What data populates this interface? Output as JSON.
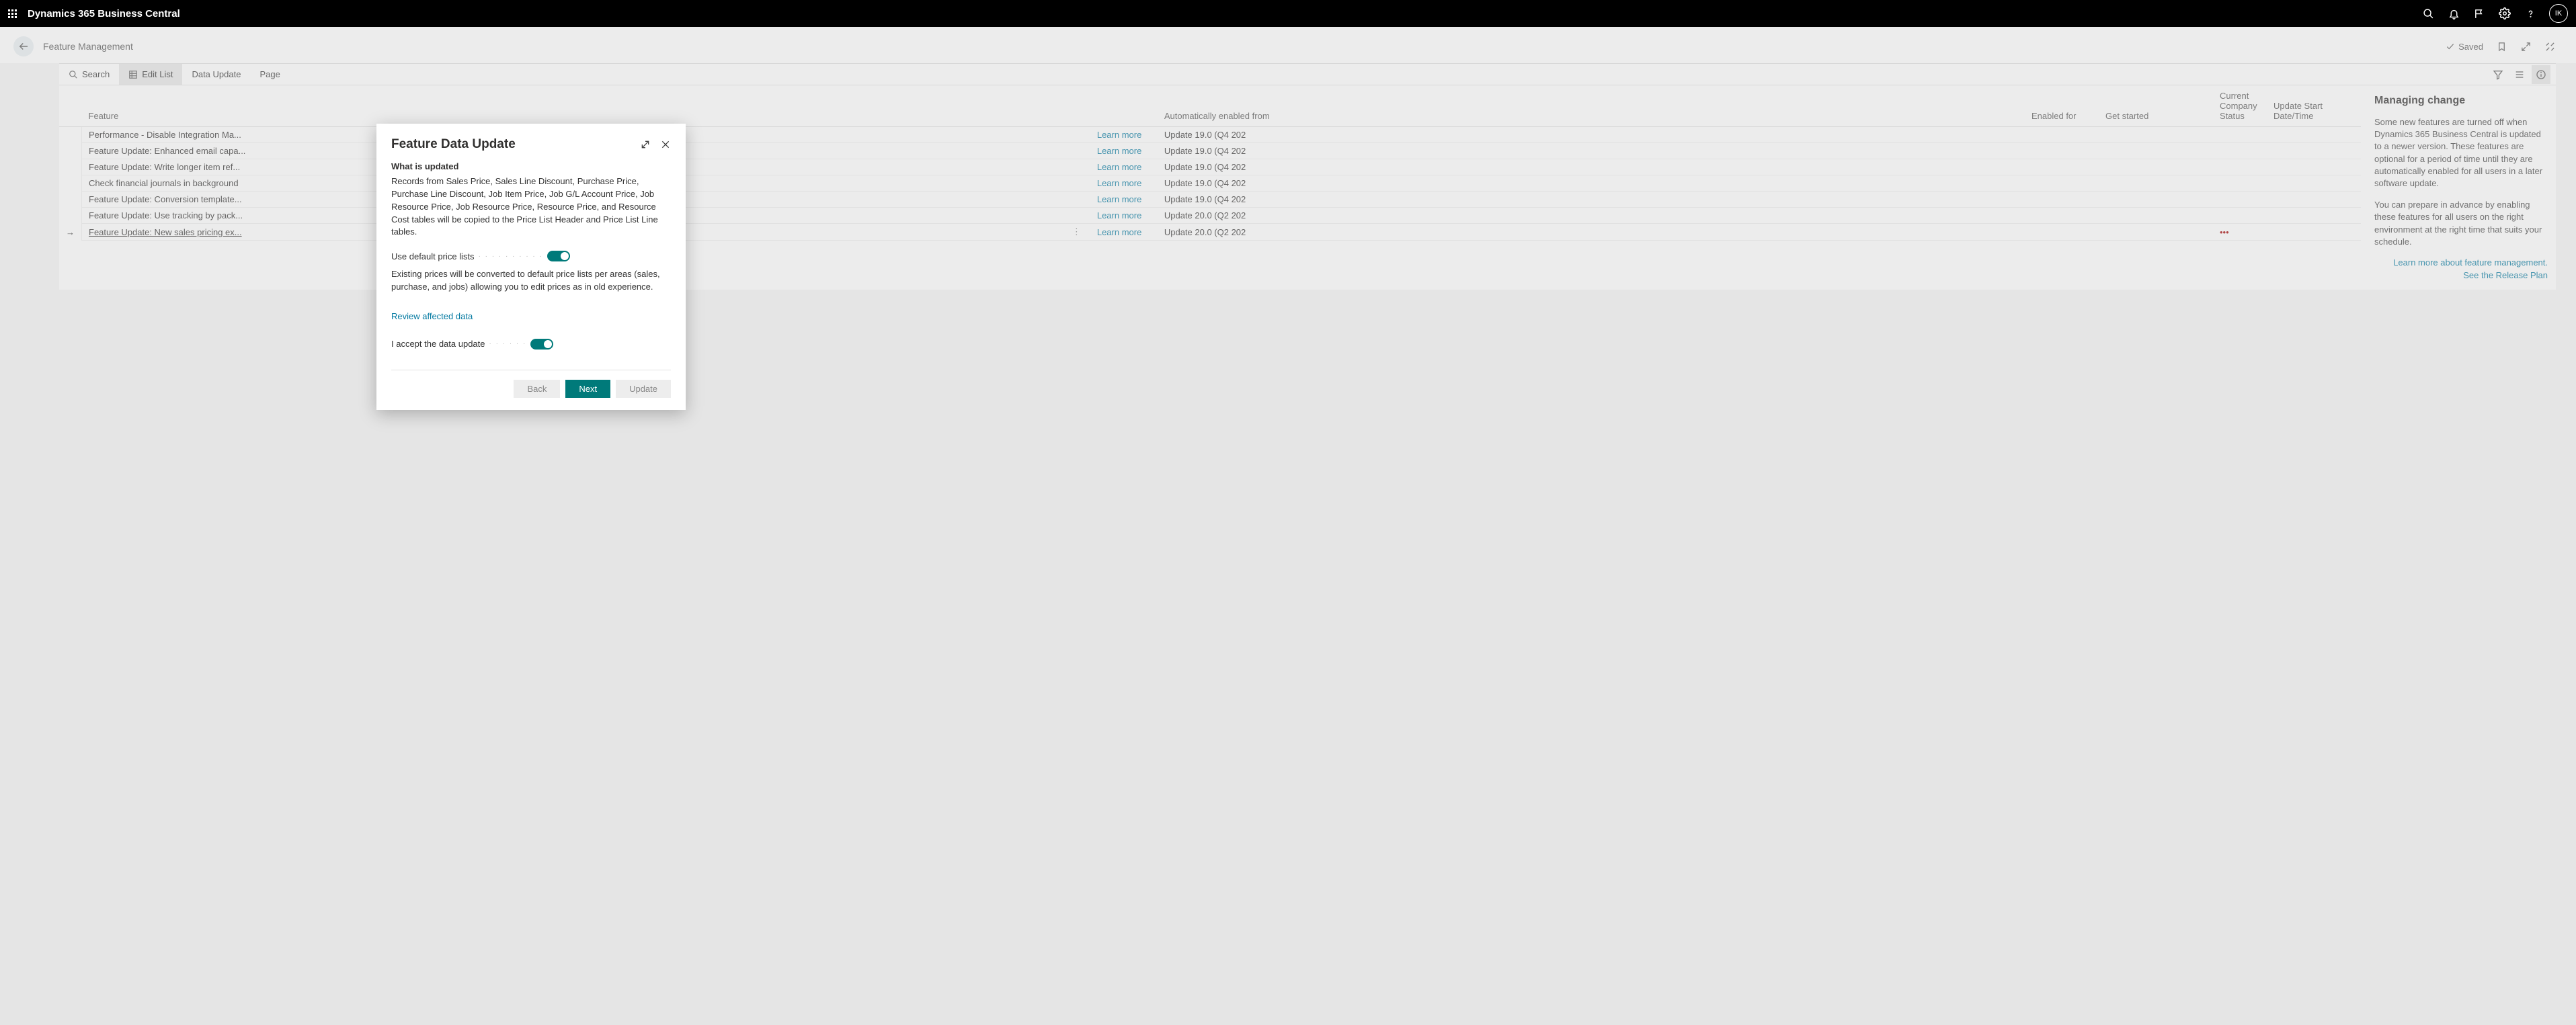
{
  "topbar": {
    "app_title": "Dynamics 365 Business Central",
    "avatar_initials": "IK"
  },
  "page_header": {
    "title": "Feature Management",
    "saved_label": "Saved"
  },
  "toolbar": {
    "search": "Search",
    "edit_list": "Edit List",
    "data_update": "Data Update",
    "page": "Page"
  },
  "grid": {
    "columns": {
      "feature": "Feature",
      "learn": "",
      "auto_from": "Automatically enabled from",
      "enabled_for": "Enabled for",
      "get_started": "Get started",
      "company_status": "Current Company Status",
      "update_start": "Update Start Date/Time"
    },
    "learn_more": "Learn more",
    "rows": [
      {
        "feature": "Performance - Disable Integration Ma...",
        "auto": "Update 19.0 (Q4 202"
      },
      {
        "feature": "Feature Update: Enhanced email capa...",
        "auto": "Update 19.0 (Q4 202"
      },
      {
        "feature": "Feature Update: Write longer item ref...",
        "auto": "Update 19.0 (Q4 202"
      },
      {
        "feature": "Check financial journals in background",
        "auto": "Update 19.0 (Q4 202"
      },
      {
        "feature": "Feature Update: Conversion template...",
        "auto": "Update 19.0 (Q4 202"
      },
      {
        "feature": "Feature Update: Use tracking by pack...",
        "auto": "Update 20.0 (Q2 202"
      },
      {
        "feature": "Feature Update: New sales pricing ex...",
        "auto": "Update 20.0 (Q2 202"
      }
    ]
  },
  "side": {
    "heading": "Managing change",
    "p1": "Some new features are turned off when Dynamics 365 Business Central is updated to a newer version. These features are optional for a period of time until they are automatically enabled for all users in a later software update.",
    "p2": "You can prepare in advance by enabling these features for all users on the right environment at the right time that suits your schedule.",
    "link1": "Learn more about feature management.",
    "link2": "See the Release Plan"
  },
  "modal": {
    "title": "Feature Data Update",
    "what_heading": "What is updated",
    "what_body": "Records from Sales Price, Sales Line Discount, Purchase Price, Purchase Line Discount, Job Item Price, Job G/L Account Price, Job Resource Price, Job Resource Price, Resource Price, and Resource Cost tables will be copied to the Price List Header and Price List Line tables.",
    "toggle1_label": "Use default price lists",
    "toggle1_desc": "Existing prices will be converted to default price lists per areas (sales, purchase, and jobs) allowing you to edit prices as in old experience.",
    "review_link": "Review affected data",
    "toggle2_label": "I accept the data update",
    "btn_back": "Back",
    "btn_next": "Next",
    "btn_update": "Update"
  }
}
